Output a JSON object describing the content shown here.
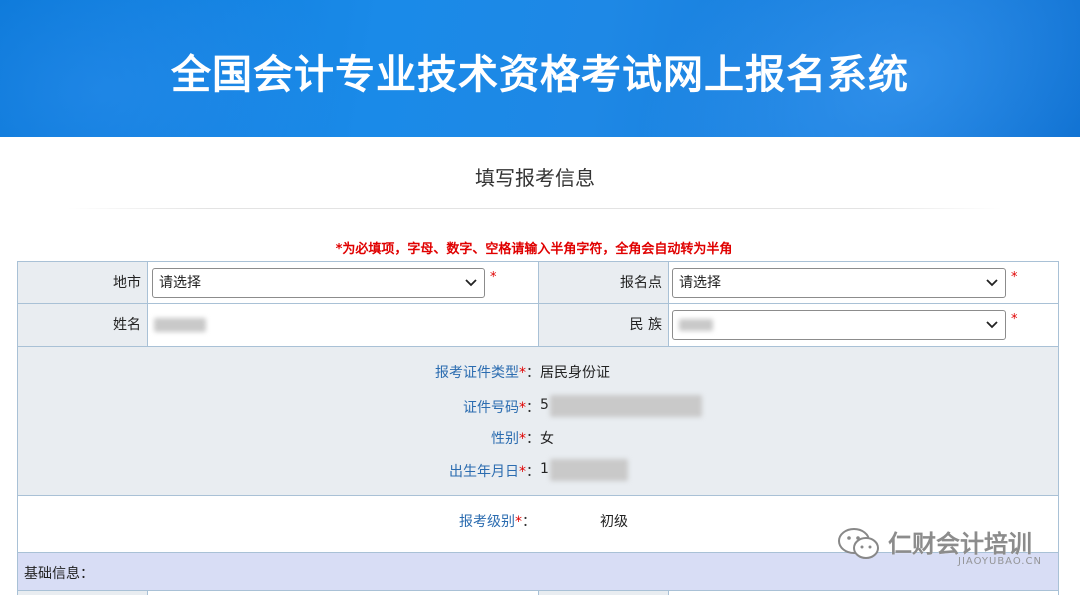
{
  "header": {
    "title": "全国会计专业技术资格考试网上报名系统"
  },
  "page": {
    "title": "填写报考信息",
    "notice": "*为必填项，字母、数字、空格请输入半角字符，全角会自动转为半角"
  },
  "form": {
    "city": {
      "label": "地市",
      "value": "请选择",
      "required": "*"
    },
    "site": {
      "label": "报名点",
      "value": "请选择",
      "required": "*"
    },
    "name": {
      "label": "姓名",
      "value": ""
    },
    "ethnicity": {
      "label": "民 族",
      "value": "",
      "required": "*"
    },
    "id_info": {
      "id_type": {
        "label": "报考证件类型",
        "required": "*",
        "colon": "：",
        "value": "居民身份证"
      },
      "id_number": {
        "label": "证件号码",
        "required": "*",
        "colon": "：",
        "value": "5"
      },
      "gender": {
        "label": "性别",
        "required": "*",
        "colon": "：",
        "value": "女"
      },
      "birth_date": {
        "label": "出生年月日",
        "required": "*",
        "colon": "：",
        "value": "1"
      }
    },
    "level": {
      "label": "报考级别",
      "required": "*",
      "colon": "：",
      "value": "初级"
    },
    "basic_info": {
      "label": "基础信息："
    }
  },
  "watermark": {
    "text": "仁财会计培训",
    "sub": "JIAOYUBAO.CN"
  },
  "colors": {
    "banner": "#1a8ae8",
    "required": "#e00000",
    "label_blue": "#2b6cb0",
    "row_bg": "#e9edf1",
    "section_bg": "#d8ddf5"
  }
}
